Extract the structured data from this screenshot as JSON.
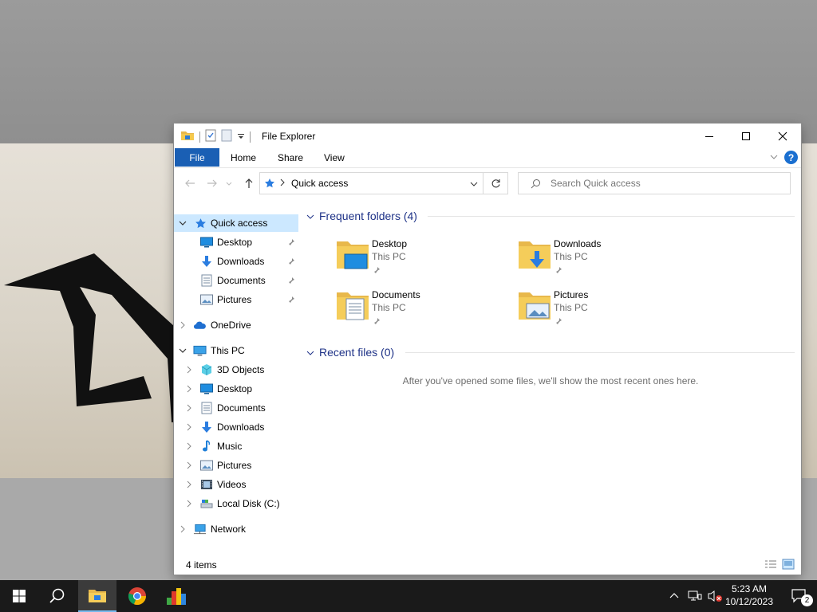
{
  "window": {
    "title": "File Explorer",
    "ribbon_tabs": {
      "file": "File",
      "home": "Home",
      "share": "Share",
      "view": "View"
    },
    "help": "?",
    "address": {
      "path": "Quick access"
    },
    "search": {
      "placeholder": "Search Quick access"
    }
  },
  "nav_pane": {
    "quick_access": "Quick access",
    "quick_items": [
      "Desktop",
      "Downloads",
      "Documents",
      "Pictures"
    ],
    "onedrive": "OneDrive",
    "this_pc": "This PC",
    "pc_items": [
      "3D Objects",
      "Desktop",
      "Documents",
      "Downloads",
      "Music",
      "Pictures",
      "Videos",
      "Local Disk (C:)"
    ],
    "network": "Network"
  },
  "content": {
    "frequent_header": "Frequent folders (4)",
    "recent_header": "Recent files (0)",
    "folders": [
      {
        "name": "Desktop",
        "location": "This PC"
      },
      {
        "name": "Downloads",
        "location": "This PC"
      },
      {
        "name": "Documents",
        "location": "This PC"
      },
      {
        "name": "Pictures",
        "location": "This PC"
      }
    ],
    "empty_message": "After you've opened some files, we'll show the most recent ones here."
  },
  "status": {
    "items": "4 items"
  },
  "taskbar": {
    "clock_time": "5:23 AM",
    "clock_date": "10/12/2023",
    "notification_count": "2"
  },
  "colors": {
    "accent": "#1a5fb4",
    "selection": "#cce8ff",
    "header_blue": "#1e3287",
    "taskbar": "#1a1a1a"
  }
}
